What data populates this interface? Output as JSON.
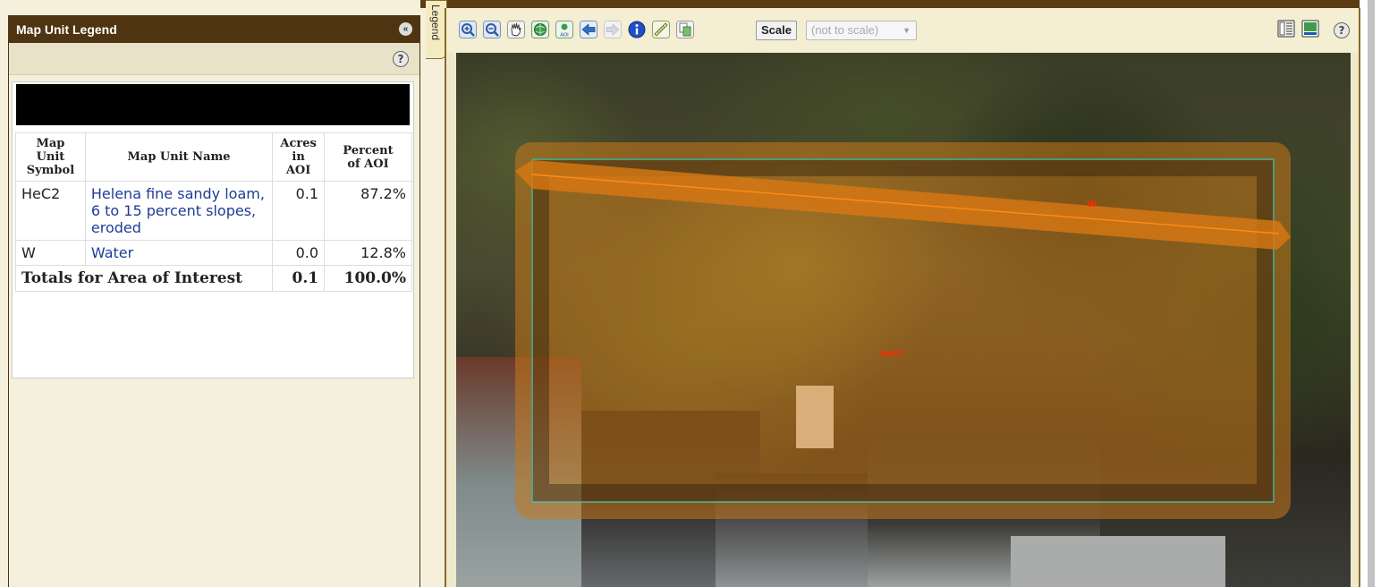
{
  "legend_panel": {
    "title": "Map Unit Legend",
    "help_label": "?",
    "collapse_glyph": "«"
  },
  "side_tab": {
    "label": "Legend"
  },
  "table": {
    "headers": [
      "Map Unit Symbol",
      "Map Unit Name",
      "Acres in AOI",
      "Percent of AOI"
    ],
    "header_lines": {
      "symbol": [
        "Map",
        "Unit",
        "Symbol"
      ],
      "acres": [
        "Acres",
        "in",
        "AOI"
      ],
      "percent": [
        "Percent",
        "of AOI"
      ]
    },
    "rows": [
      {
        "symbol": "HeC2",
        "name": "Helena fine sandy loam, 6 to 15 percent slopes, eroded",
        "acres": "0.1",
        "percent": "87.2%"
      },
      {
        "symbol": "W",
        "name": "Water",
        "acres": "0.0",
        "percent": "12.8%"
      }
    ],
    "totals": {
      "label": "Totals for Area of Interest",
      "acres": "0.1",
      "percent": "100.0%"
    }
  },
  "toolbar": {
    "tools": [
      "zoom-in-icon",
      "zoom-out-icon",
      "pan-hand-icon",
      "full-extent-globe-icon",
      "zoom-to-aoi-icon",
      "back-arrow-icon",
      "forward-arrow-icon",
      "identify-info-icon",
      "measure-ruler-icon",
      "print-copy-icon"
    ],
    "scale_label": "Scale",
    "scale_value": "(not to scale)",
    "right_tools": [
      "layout-toggle-icon",
      "map-overview-icon"
    ],
    "help_label": "?"
  },
  "map": {
    "unit_labels": {
      "water": "W",
      "helena": "HeC2"
    },
    "colors": {
      "aoi_fill": "#c8781a",
      "aoi_line": "#48c8b0",
      "boundary_line": "#ff8c1a",
      "label_text": "#ff2a00"
    }
  }
}
